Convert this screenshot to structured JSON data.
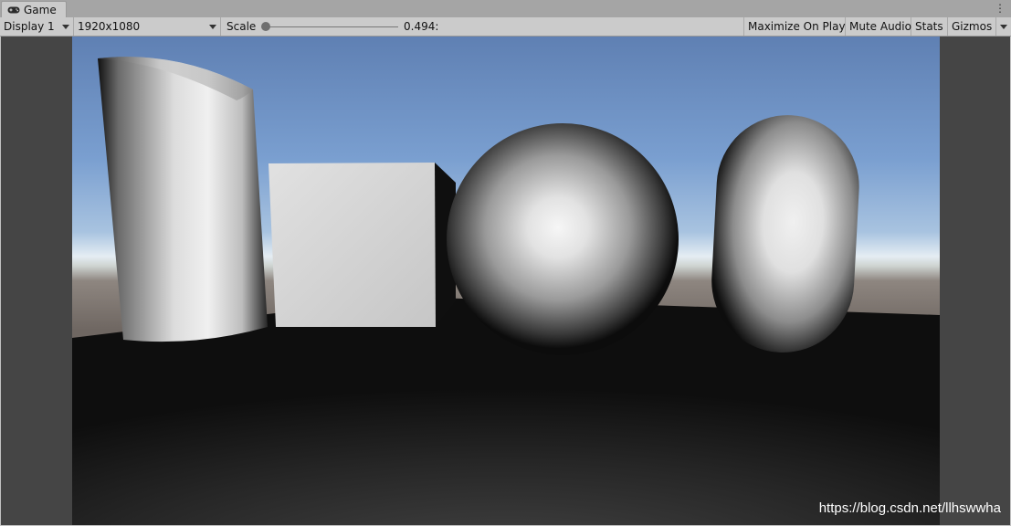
{
  "window": {
    "tab_label": "Game",
    "tab_icon": "gamepad-icon"
  },
  "toolbar": {
    "display": "Display 1",
    "resolution": "1920x1080",
    "scale_label": "Scale",
    "scale_value": "0.494:",
    "scale_fraction": 0.0,
    "maximize_on_play": "Maximize On Play",
    "mute_audio": "Mute Audio",
    "stats": "Stats",
    "gizmos": "Gizmos"
  },
  "watermark": "https://blog.csdn.net/llhswwha",
  "colors": {
    "sky_top": "#5f83b6",
    "sky_horizon": "#e4ecf2",
    "ground_far": "#766e6a",
    "floor": "#161616",
    "side_bars": "#454545"
  }
}
